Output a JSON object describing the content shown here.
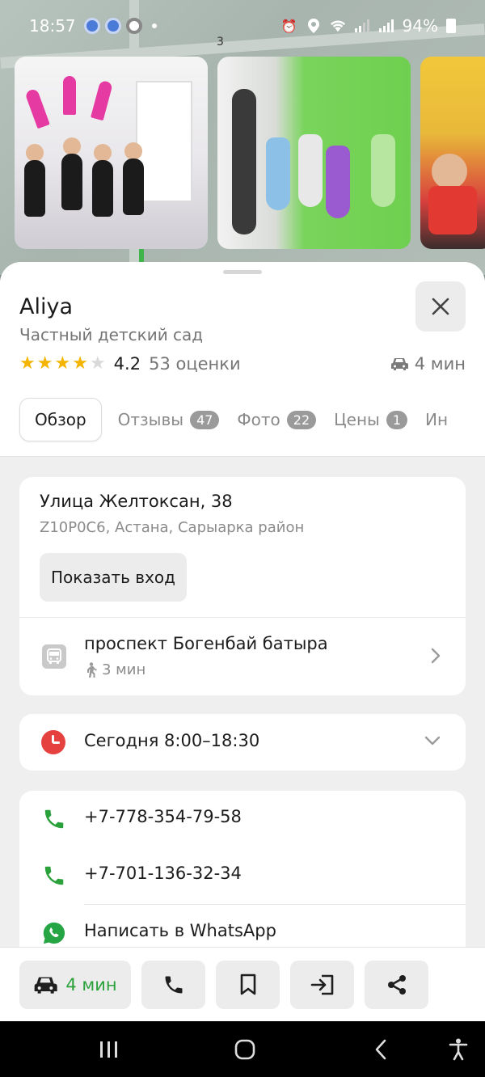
{
  "status_bar": {
    "time": "18:57",
    "battery": "94%",
    "map_label": "3"
  },
  "place": {
    "name": "Aliya",
    "category": "Частный детский сад",
    "rating": "4.2",
    "rating_stars": 4,
    "rating_count": "53 оценки",
    "drive_eta": "4 мин"
  },
  "tabs": [
    {
      "label": "Обзор",
      "badge": ""
    },
    {
      "label": "Отзывы",
      "badge": "47"
    },
    {
      "label": "Фото",
      "badge": "22"
    },
    {
      "label": "Цены",
      "badge": "1"
    },
    {
      "label": "Ин",
      "badge": ""
    }
  ],
  "address": {
    "street": "Улица Желтоксан, 38",
    "details": "Z10P0C6, Астана, Сарыарка район",
    "entrance_button": "Показать вход"
  },
  "transit": {
    "stop_name": "проспект Богенбай батыра",
    "walk_time": "3 мин"
  },
  "hours": {
    "text": "Сегодня 8:00–18:30"
  },
  "contacts": {
    "phone1": "+7-778-354-79-58",
    "phone2": "+7-701-136-32-34",
    "whatsapp": "Написать в WhatsApp"
  },
  "actions": {
    "route_eta": "4 мин"
  },
  "colors": {
    "star": "#f5b400",
    "accent_green": "#2aa13a",
    "clock_red": "#e5413f",
    "whatsapp_green": "#25a544"
  }
}
